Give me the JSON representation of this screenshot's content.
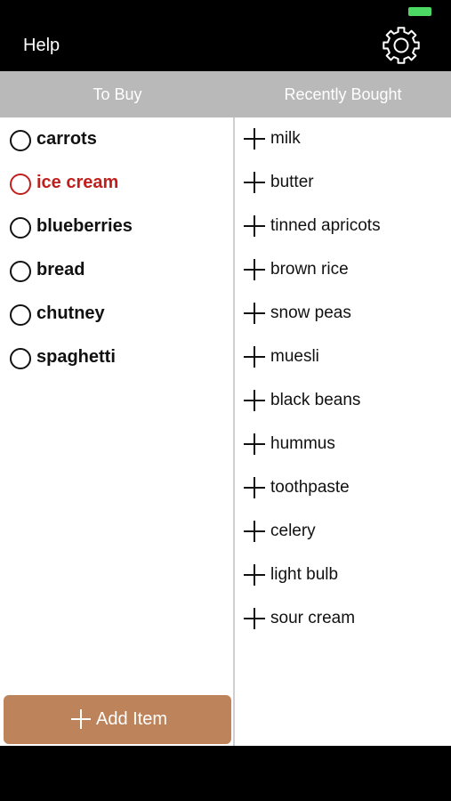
{
  "nav": {
    "help_label": "Help",
    "settings_icon": "gear-icon"
  },
  "tabs": {
    "to_buy": "To Buy",
    "recently_bought": "Recently Bought"
  },
  "to_buy_items": [
    {
      "label": "carrots",
      "highlighted": false
    },
    {
      "label": "ice cream",
      "highlighted": true
    },
    {
      "label": "blueberries",
      "highlighted": false
    },
    {
      "label": "bread",
      "highlighted": false
    },
    {
      "label": "chutney",
      "highlighted": false
    },
    {
      "label": "spaghetti",
      "highlighted": false
    }
  ],
  "recently_bought_items": [
    "milk",
    "butter",
    "tinned apricots",
    "brown rice",
    "snow peas",
    "muesli",
    "black beans",
    "hummus",
    "toothpaste",
    "celery",
    "light bulb",
    "sour cream"
  ],
  "add_button": {
    "label": "Add Item"
  },
  "colors": {
    "tab_bar": "#b9b9b9",
    "highlight_red": "#c0201d",
    "add_button": "#bd845c",
    "battery_green": "#4cd964"
  }
}
